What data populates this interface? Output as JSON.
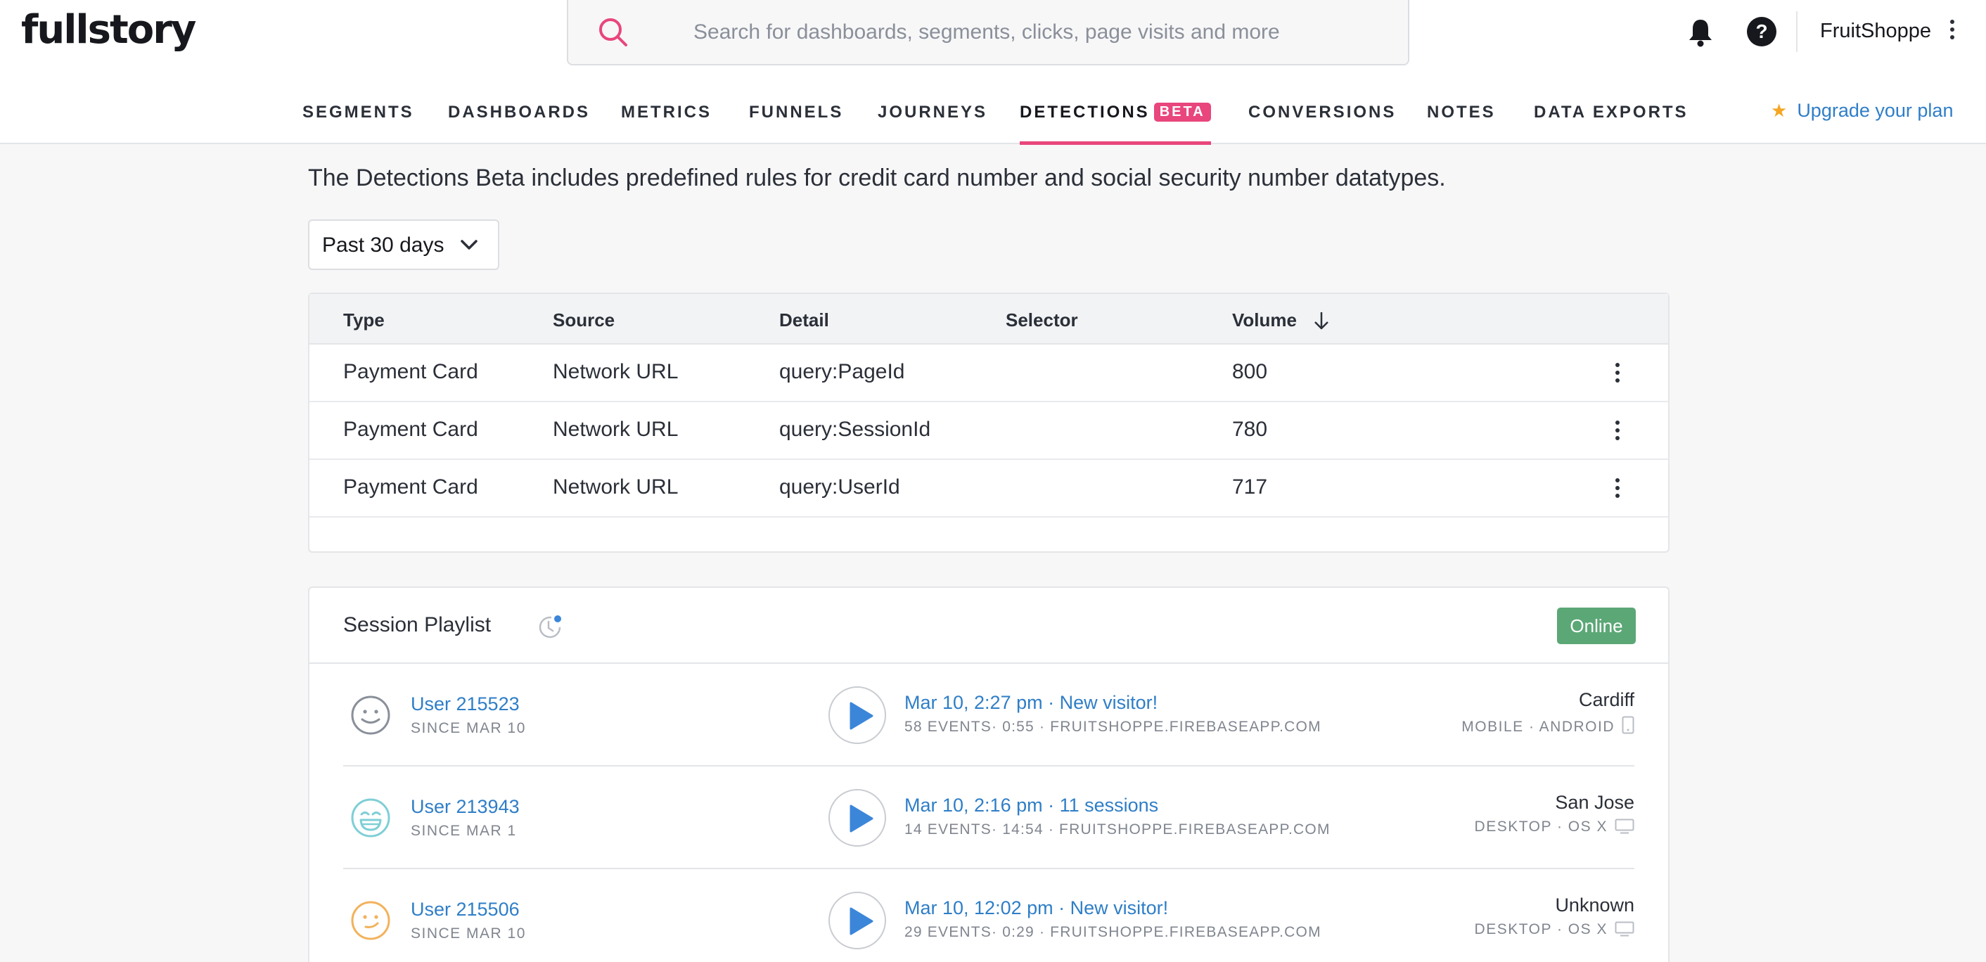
{
  "header": {
    "logo": "fullstory",
    "search_placeholder": "Search for dashboards, segments, clicks, page visits and more",
    "account_name": "FruitShoppe",
    "help_label": "?",
    "upgrade_label": "Upgrade your plan"
  },
  "nav": {
    "items": [
      "SEGMENTS",
      "DASHBOARDS",
      "METRICS",
      "FUNNELS",
      "JOURNEYS",
      "DETECTIONS",
      "CONVERSIONS",
      "NOTES",
      "DATA EXPORTS"
    ],
    "active": "DETECTIONS",
    "beta_badge": "BETA"
  },
  "intro_text": "The Detections Beta includes predefined rules for credit card number and social security number datatypes.",
  "date_range": "Past 30 days",
  "detections_table": {
    "columns": [
      "Type",
      "Source",
      "Detail",
      "Selector",
      "Volume"
    ],
    "sort_column": "Volume",
    "rows": [
      {
        "type": "Payment Card",
        "source": "Network URL",
        "detail": "query:PageId",
        "selector": "",
        "volume": "800"
      },
      {
        "type": "Payment Card",
        "source": "Network URL",
        "detail": "query:SessionId",
        "selector": "",
        "volume": "780"
      },
      {
        "type": "Payment Card",
        "source": "Network URL",
        "detail": "query:UserId",
        "selector": "",
        "volume": "717"
      }
    ]
  },
  "playlist": {
    "title": "Session Playlist",
    "status": "Online",
    "sessions": [
      {
        "user": "User 215523",
        "since": "SINCE MAR 10",
        "time": "Mar 10, 2:27 pm · New visitor!",
        "meta": "58 EVENTS· 0:55 · FRUITSHOPPE.FIREBASEAPP.COM",
        "city": "Cardiff",
        "device": "MOBILE · ANDROID",
        "face_color": "#8a8f99"
      },
      {
        "user": "User 213943",
        "since": "SINCE MAR 1",
        "time": "Mar 10, 2:16 pm · 11 sessions",
        "meta": "14 EVENTS· 14:54 · FRUITSHOPPE.FIREBASEAPP.COM",
        "city": "San Jose",
        "device": "DESKTOP · OS X",
        "face_color": "#7fcfd6"
      },
      {
        "user": "User 215506",
        "since": "SINCE MAR 10",
        "time": "Mar 10, 12:02 pm · New visitor!",
        "meta": "29 EVENTS· 0:29 · FRUITSHOPPE.FIREBASEAPP.COM",
        "city": "Unknown",
        "device": "DESKTOP · OS X",
        "face_color": "#f2b25c"
      }
    ]
  },
  "colors": {
    "accent_pink": "#e8467c",
    "link_blue": "#2f7ec7",
    "online_green": "#5ba776",
    "play_blue": "#3b86d9"
  }
}
